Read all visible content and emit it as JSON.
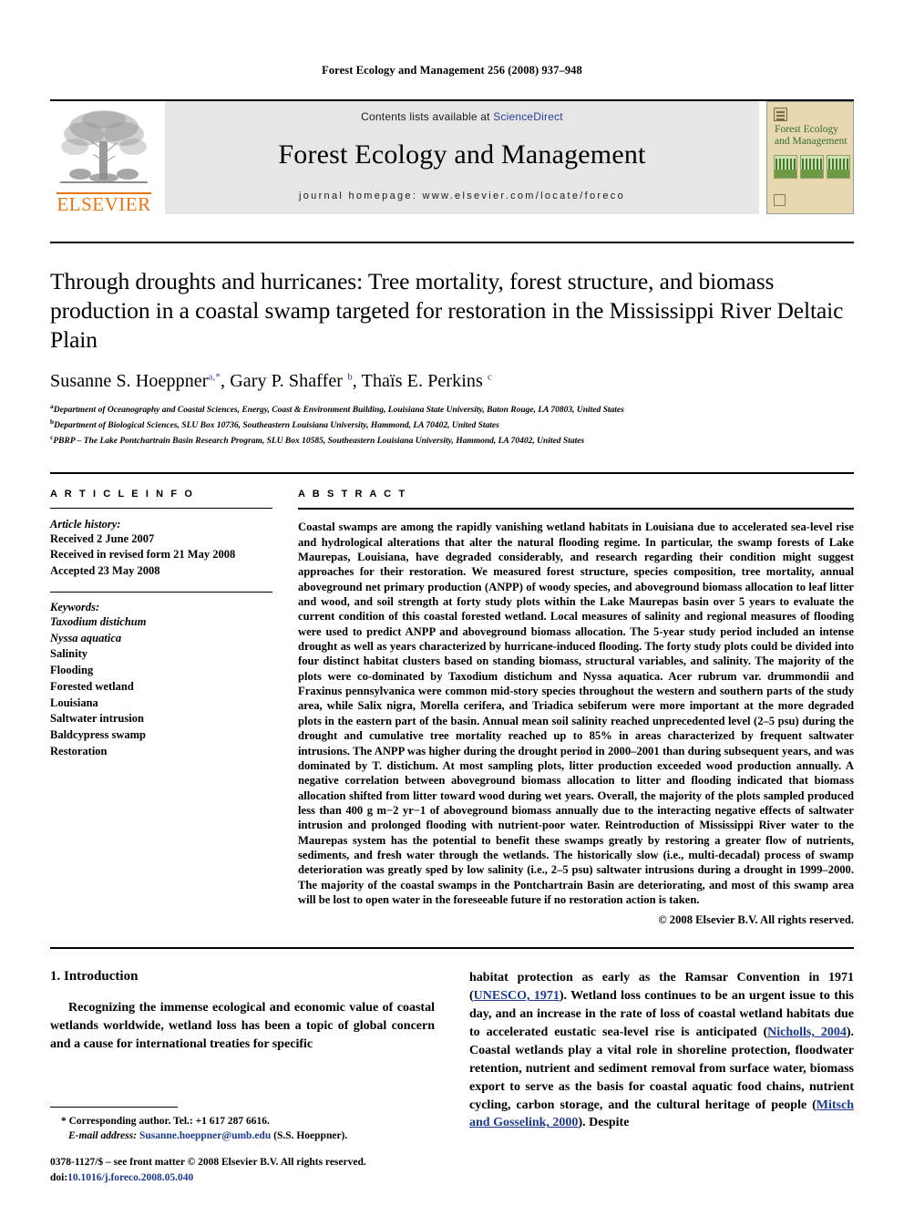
{
  "running_head": "Forest Ecology and Management 256 (2008) 937–948",
  "masthead": {
    "contents_prefix": "Contents lists available at ",
    "sciencedirect": "ScienceDirect",
    "journal_title": "Forest Ecology and Management",
    "homepage": "journal homepage: www.elsevier.com/locate/foreco",
    "publisher": "ELSEVIER",
    "cover_title": "Forest Ecology and Management",
    "link_color": "#2b3f9e"
  },
  "article": {
    "title": "Through droughts and hurricanes: Tree mortality, forest structure, and biomass production in a coastal swamp targeted for restoration in the Mississippi River Deltaic Plain",
    "authors": [
      {
        "name": "Susanne S. Hoeppner",
        "sup": "a,*"
      },
      {
        "name": "Gary P. Shaffer",
        "sup": "b"
      },
      {
        "name": "Thaïs E. Perkins",
        "sup": "c"
      }
    ],
    "affiliations": [
      {
        "mark": "a",
        "text": "Department of Oceanography and Coastal Sciences, Energy, Coast & Environment Building, Louisiana State University, Baton Rouge, LA 70803, United States"
      },
      {
        "mark": "b",
        "text": "Department of Biological Sciences, SLU Box 10736, Southeastern Louisiana University, Hammond, LA 70402, United States"
      },
      {
        "mark": "c",
        "text": "PBRP – The Lake Pontchartrain Basin Research Program, SLU Box 10585, Southeastern Louisiana University, Hammond, LA 70402, United States"
      }
    ]
  },
  "info": {
    "heading": "A R T I C L E   I N F O",
    "history_label": "Article history:",
    "history": [
      "Received 2 June 2007",
      "Received in revised form 21 May 2008",
      "Accepted 23 May 2008"
    ],
    "keywords_label": "Keywords:",
    "keywords": [
      {
        "text": "Taxodium distichum",
        "italic": true
      },
      {
        "text": "Nyssa aquatica",
        "italic": true
      },
      {
        "text": "Salinity",
        "italic": false
      },
      {
        "text": "Flooding",
        "italic": false
      },
      {
        "text": "Forested wetland",
        "italic": false
      },
      {
        "text": "Louisiana",
        "italic": false
      },
      {
        "text": "Saltwater intrusion",
        "italic": false
      },
      {
        "text": "Baldcypress swamp",
        "italic": false
      },
      {
        "text": "Restoration",
        "italic": false
      }
    ]
  },
  "abstract": {
    "heading": "A B S T R A C T",
    "paragraphs": [
      "Coastal swamps are among the rapidly vanishing wetland habitats in Louisiana due to accelerated sea-level rise and hydrological alterations that alter the natural flooding regime. In particular, the swamp forests of Lake Maurepas, Louisiana, have degraded considerably, and research regarding their condition might suggest approaches for their restoration. We measured forest structure, species composition, tree mortality, annual aboveground net primary production (ANPP) of woody species, and aboveground biomass allocation to leaf litter and wood, and soil strength at forty study plots within the Lake Maurepas basin over 5 years to evaluate the current condition of this coastal forested wetland. Local measures of salinity and regional measures of flooding were used to predict ANPP and aboveground biomass allocation. The 5-year study period included an intense drought as well as years characterized by hurricane-induced flooding. The forty study plots could be divided into four distinct habitat clusters based on standing biomass, structural variables, and salinity. The majority of the plots were co-dominated by Taxodium distichum and Nyssa aquatica. Acer rubrum var. drummondii and Fraxinus pennsylvanica were common mid-story species throughout the western and southern parts of the study area, while Salix nigra, Morella cerifera, and Triadica sebiferum were more important at the more degraded plots in the eastern part of the basin. Annual mean soil salinity reached unprecedented level (2–5 psu) during the drought and cumulative tree mortality reached up to 85% in areas characterized by frequent saltwater intrusions. The ANPP was higher during the drought period in 2000–2001 than during subsequent years, and was dominated by T. distichum. At most sampling plots, litter production exceeded wood production annually. A negative correlation between aboveground biomass allocation to litter and flooding indicated that biomass allocation shifted from litter toward wood during wet years. Overall, the majority of the plots sampled produced less than 400 g m−2 yr−1 of aboveground biomass annually due to the interacting negative effects of saltwater intrusion and prolonged flooding with nutrient-poor water. Reintroduction of Mississippi River water to the Maurepas system has the potential to benefit these swamps greatly by restoring a greater flow of nutrients, sediments, and fresh water through the wetlands. The historically slow (i.e., multi-decadal) process of swamp deterioration was greatly sped by low salinity (i.e., 2–5 psu) saltwater intrusions during a drought in 1999–2000. The majority of the coastal swamps in the Pontchartrain Basin are deteriorating, and most of this swamp area will be lost to open water in the foreseeable future if no restoration action is taken."
    ],
    "copyright": "© 2008 Elsevier B.V. All rights reserved."
  },
  "body": {
    "section_number_title": "1. Introduction",
    "left_paragraph": "Recognizing the immense ecological and economic value of coastal wetlands worldwide, wetland loss has been a topic of global concern and a cause for international treaties for specific",
    "right_paragraph_1": "habitat protection as early as the Ramsar Convention in 1971 (",
    "cite_1": "UNESCO, 1971",
    "right_paragraph_2": "). Wetland loss continues to be an urgent issue to this day, and an increase in the rate of loss of coastal wetland habitats due to accelerated eustatic sea-level rise is anticipated (",
    "cite_2": "Nicholls, 2004",
    "right_paragraph_3": "). Coastal wetlands play a vital role in shoreline protection, floodwater retention, nutrient and sediment removal from surface water, biomass export to serve as the basis for coastal aquatic food chains, nutrient cycling, carbon storage, and the cultural heritage of people (",
    "cite_3": "Mitsch and Gosselink, 2000",
    "right_paragraph_4": "). Despite"
  },
  "footnotes": {
    "corresponding": "* Corresponding author. Tel.: +1 617 287 6616.",
    "email_label": "E-mail address:",
    "email": "Susanne.hoeppner@umb.edu",
    "email_suffix": "(S.S. Hoeppner)."
  },
  "footer": {
    "issn_line": "0378-1127/$ – see front matter © 2008 Elsevier B.V. All rights reserved.",
    "doi_label": "doi:",
    "doi": "10.1016/j.foreco.2008.05.040"
  }
}
